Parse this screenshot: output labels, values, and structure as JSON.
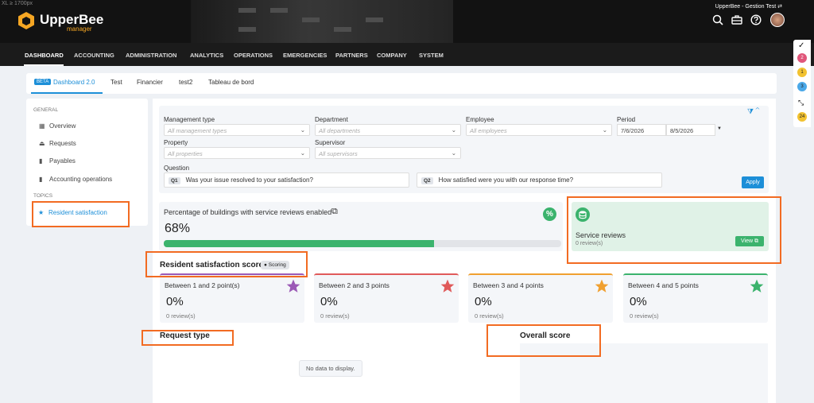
{
  "breakpoint": "XL ≥ 1700px",
  "app": {
    "name": "UpperBee",
    "sub": "manager",
    "tenant": "UpperBee - Gestion Test ⇄"
  },
  "nav": [
    "DASHBOARD",
    "ACCOUNTING",
    "ADMINISTRATION",
    "ANALYTICS",
    "OPERATIONS",
    "EMERGENCIES",
    "PARTNERS",
    "COMPANY",
    "SYSTEM"
  ],
  "tabs": {
    "beta": "BETA",
    "active": "Dashboard 2.0",
    "others": [
      "Test",
      "Financier",
      "test2",
      "Tableau de bord"
    ]
  },
  "sidebar": {
    "general": "GENERAL",
    "items": [
      "Overview",
      "Requests",
      "Payables",
      "Accounting operations"
    ],
    "topics": "TOPICS",
    "topic": "Resident satisfaction"
  },
  "filters": {
    "management_type": {
      "label": "Management type",
      "placeholder": "All management types"
    },
    "department": {
      "label": "Department",
      "placeholder": "All departments"
    },
    "employee": {
      "label": "Employee",
      "placeholder": "All employees"
    },
    "period": {
      "label": "Period",
      "from": "7/6/2026",
      "to": "8/5/2026"
    },
    "property": {
      "label": "Property",
      "placeholder": "All properties"
    },
    "supervisor": {
      "label": "Supervisor",
      "placeholder": "All supervisors"
    },
    "question": {
      "label": "Question",
      "q1": "Q1",
      "q1_text": "Was your issue resolved to your satisfaction?",
      "q2": "Q2",
      "q2_text": "How satisfied were you with our response time?"
    },
    "apply": "Apply"
  },
  "percentage_card": {
    "title": "Percentage of buildings with service reviews enabled",
    "value": "68%",
    "fraction": 0.68
  },
  "service_reviews": {
    "title": "Service reviews",
    "count": "0 review(s)",
    "view": "View"
  },
  "satisfaction": {
    "title": "Resident satisfaction score",
    "badge": "Scoring",
    "cards": [
      {
        "label": "Between 1 and 2 point(s)",
        "value": "0%",
        "reviews": "0 review(s)",
        "color": "#9b59b6"
      },
      {
        "label": "Between 2 and 3 points",
        "value": "0%",
        "reviews": "0 review(s)",
        "color": "#e05a5a"
      },
      {
        "label": "Between 3 and 4 points",
        "value": "0%",
        "reviews": "0 review(s)",
        "color": "#f0a030"
      },
      {
        "label": "Between 4 and 5 points",
        "value": "0%",
        "reviews": "0 review(s)",
        "color": "#3bb36d"
      }
    ]
  },
  "request_type": {
    "title": "Request type",
    "empty": "No data to display."
  },
  "overall": {
    "title": "Overall score"
  },
  "right_panel": {
    "badges": [
      "2",
      "1",
      "3",
      "24"
    ]
  },
  "colors": {
    "accent": "#1d8fd8",
    "success": "#3bb36d",
    "annotation": "#f26b22"
  }
}
